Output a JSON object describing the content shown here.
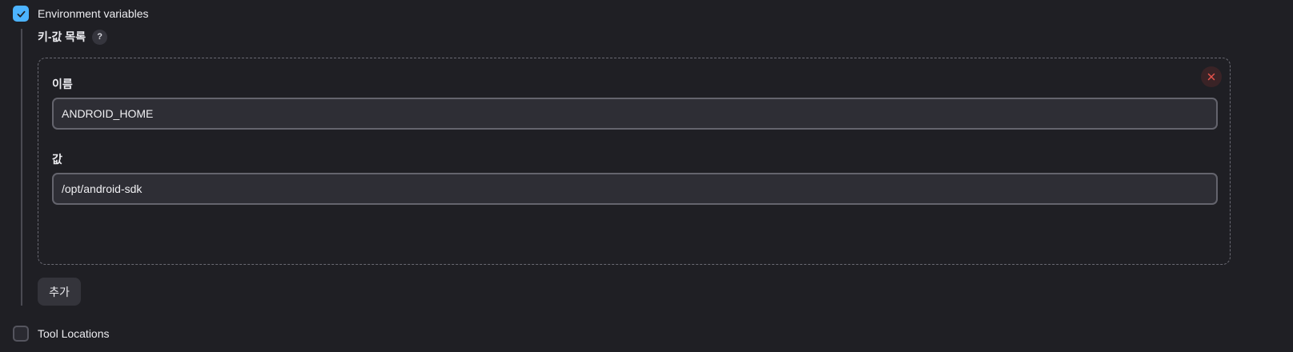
{
  "env_vars": {
    "label": "Environment variables",
    "checked": true
  },
  "kv_list": {
    "title": "키-값 목록",
    "help_icon": "?",
    "entries": [
      {
        "name_label": "이름",
        "name_value": "ANDROID_HOME",
        "value_label": "값",
        "value_value": "/opt/android-sdk"
      }
    ],
    "add_label": "추가"
  },
  "tool_locations": {
    "label": "Tool Locations",
    "checked": false
  },
  "colors": {
    "accent": "#4cb3ff",
    "background": "#1f1f24",
    "danger": "#e5534b"
  }
}
